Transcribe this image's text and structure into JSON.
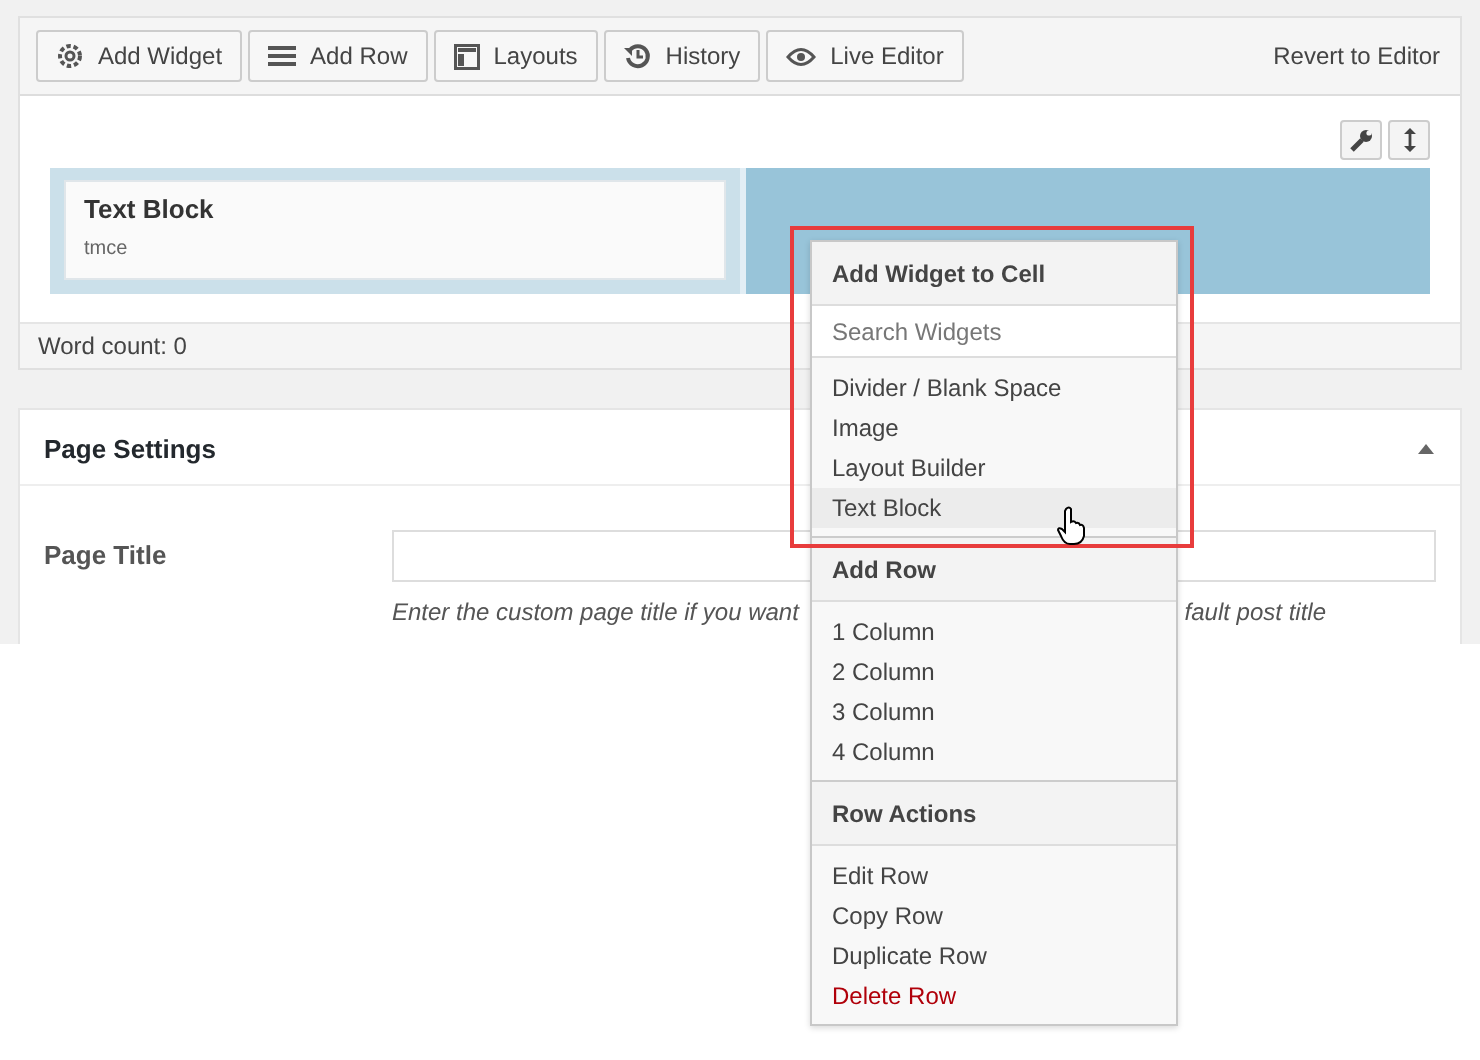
{
  "toolbar": {
    "buttons": [
      {
        "label": "Add Widget",
        "kind": "gear"
      },
      {
        "label": "Add Row",
        "kind": "lines"
      },
      {
        "label": "Layouts",
        "kind": "layout"
      },
      {
        "label": "History",
        "kind": "history"
      },
      {
        "label": "Live Editor",
        "kind": "eye"
      }
    ],
    "revert_link": "Revert to Editor"
  },
  "builder": {
    "widget": {
      "title": "Text Block",
      "subtitle": "tmce"
    }
  },
  "word_count": "Word count: 0",
  "page_settings": {
    "title": "Page Settings",
    "field_label": "Page Title",
    "description": "Enter the custom page title if you want",
    "description_tail": "fault post title"
  },
  "menu": {
    "sections": [
      {
        "heading": "Add Widget to Cell",
        "search_placeholder": "Search Widgets",
        "items": [
          {
            "label": "Divider / Blank Space",
            "selected": false,
            "kind": "normal"
          },
          {
            "label": "Image",
            "selected": false,
            "kind": "normal"
          },
          {
            "label": "Layout Builder",
            "selected": false,
            "kind": "normal"
          },
          {
            "label": "Text Block",
            "selected": true,
            "kind": "normal"
          }
        ]
      },
      {
        "heading": "Add Row",
        "items": [
          {
            "label": "1 Column",
            "selected": false,
            "kind": "normal"
          },
          {
            "label": "2 Column",
            "selected": false,
            "kind": "normal"
          },
          {
            "label": "3 Column",
            "selected": false,
            "kind": "normal"
          },
          {
            "label": "4 Column",
            "selected": false,
            "kind": "normal"
          }
        ]
      },
      {
        "heading": "Row Actions",
        "items": [
          {
            "label": "Edit Row",
            "selected": false,
            "kind": "normal"
          },
          {
            "label": "Copy Row",
            "selected": false,
            "kind": "normal"
          },
          {
            "label": "Duplicate Row",
            "selected": false,
            "kind": "normal"
          },
          {
            "label": "Delete Row",
            "selected": false,
            "kind": "danger"
          }
        ]
      }
    ]
  }
}
